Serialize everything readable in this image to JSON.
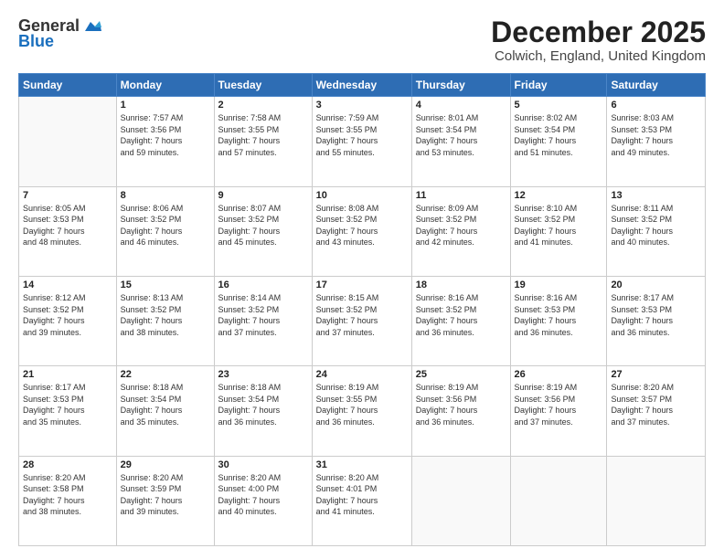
{
  "logo": {
    "general": "General",
    "blue": "Blue"
  },
  "title": "December 2025",
  "location": "Colwich, England, United Kingdom",
  "days_of_week": [
    "Sunday",
    "Monday",
    "Tuesday",
    "Wednesday",
    "Thursday",
    "Friday",
    "Saturday"
  ],
  "weeks": [
    [
      {
        "day": "",
        "info": ""
      },
      {
        "day": "1",
        "info": "Sunrise: 7:57 AM\nSunset: 3:56 PM\nDaylight: 7 hours\nand 59 minutes."
      },
      {
        "day": "2",
        "info": "Sunrise: 7:58 AM\nSunset: 3:55 PM\nDaylight: 7 hours\nand 57 minutes."
      },
      {
        "day": "3",
        "info": "Sunrise: 7:59 AM\nSunset: 3:55 PM\nDaylight: 7 hours\nand 55 minutes."
      },
      {
        "day": "4",
        "info": "Sunrise: 8:01 AM\nSunset: 3:54 PM\nDaylight: 7 hours\nand 53 minutes."
      },
      {
        "day": "5",
        "info": "Sunrise: 8:02 AM\nSunset: 3:54 PM\nDaylight: 7 hours\nand 51 minutes."
      },
      {
        "day": "6",
        "info": "Sunrise: 8:03 AM\nSunset: 3:53 PM\nDaylight: 7 hours\nand 49 minutes."
      }
    ],
    [
      {
        "day": "7",
        "info": "Sunrise: 8:05 AM\nSunset: 3:53 PM\nDaylight: 7 hours\nand 48 minutes."
      },
      {
        "day": "8",
        "info": "Sunrise: 8:06 AM\nSunset: 3:52 PM\nDaylight: 7 hours\nand 46 minutes."
      },
      {
        "day": "9",
        "info": "Sunrise: 8:07 AM\nSunset: 3:52 PM\nDaylight: 7 hours\nand 45 minutes."
      },
      {
        "day": "10",
        "info": "Sunrise: 8:08 AM\nSunset: 3:52 PM\nDaylight: 7 hours\nand 43 minutes."
      },
      {
        "day": "11",
        "info": "Sunrise: 8:09 AM\nSunset: 3:52 PM\nDaylight: 7 hours\nand 42 minutes."
      },
      {
        "day": "12",
        "info": "Sunrise: 8:10 AM\nSunset: 3:52 PM\nDaylight: 7 hours\nand 41 minutes."
      },
      {
        "day": "13",
        "info": "Sunrise: 8:11 AM\nSunset: 3:52 PM\nDaylight: 7 hours\nand 40 minutes."
      }
    ],
    [
      {
        "day": "14",
        "info": "Sunrise: 8:12 AM\nSunset: 3:52 PM\nDaylight: 7 hours\nand 39 minutes."
      },
      {
        "day": "15",
        "info": "Sunrise: 8:13 AM\nSunset: 3:52 PM\nDaylight: 7 hours\nand 38 minutes."
      },
      {
        "day": "16",
        "info": "Sunrise: 8:14 AM\nSunset: 3:52 PM\nDaylight: 7 hours\nand 37 minutes."
      },
      {
        "day": "17",
        "info": "Sunrise: 8:15 AM\nSunset: 3:52 PM\nDaylight: 7 hours\nand 37 minutes."
      },
      {
        "day": "18",
        "info": "Sunrise: 8:16 AM\nSunset: 3:52 PM\nDaylight: 7 hours\nand 36 minutes."
      },
      {
        "day": "19",
        "info": "Sunrise: 8:16 AM\nSunset: 3:53 PM\nDaylight: 7 hours\nand 36 minutes."
      },
      {
        "day": "20",
        "info": "Sunrise: 8:17 AM\nSunset: 3:53 PM\nDaylight: 7 hours\nand 36 minutes."
      }
    ],
    [
      {
        "day": "21",
        "info": "Sunrise: 8:17 AM\nSunset: 3:53 PM\nDaylight: 7 hours\nand 35 minutes."
      },
      {
        "day": "22",
        "info": "Sunrise: 8:18 AM\nSunset: 3:54 PM\nDaylight: 7 hours\nand 35 minutes."
      },
      {
        "day": "23",
        "info": "Sunrise: 8:18 AM\nSunset: 3:54 PM\nDaylight: 7 hours\nand 36 minutes."
      },
      {
        "day": "24",
        "info": "Sunrise: 8:19 AM\nSunset: 3:55 PM\nDaylight: 7 hours\nand 36 minutes."
      },
      {
        "day": "25",
        "info": "Sunrise: 8:19 AM\nSunset: 3:56 PM\nDaylight: 7 hours\nand 36 minutes."
      },
      {
        "day": "26",
        "info": "Sunrise: 8:19 AM\nSunset: 3:56 PM\nDaylight: 7 hours\nand 37 minutes."
      },
      {
        "day": "27",
        "info": "Sunrise: 8:20 AM\nSunset: 3:57 PM\nDaylight: 7 hours\nand 37 minutes."
      }
    ],
    [
      {
        "day": "28",
        "info": "Sunrise: 8:20 AM\nSunset: 3:58 PM\nDaylight: 7 hours\nand 38 minutes."
      },
      {
        "day": "29",
        "info": "Sunrise: 8:20 AM\nSunset: 3:59 PM\nDaylight: 7 hours\nand 39 minutes."
      },
      {
        "day": "30",
        "info": "Sunrise: 8:20 AM\nSunset: 4:00 PM\nDaylight: 7 hours\nand 40 minutes."
      },
      {
        "day": "31",
        "info": "Sunrise: 8:20 AM\nSunset: 4:01 PM\nDaylight: 7 hours\nand 41 minutes."
      },
      {
        "day": "",
        "info": ""
      },
      {
        "day": "",
        "info": ""
      },
      {
        "day": "",
        "info": ""
      }
    ]
  ]
}
